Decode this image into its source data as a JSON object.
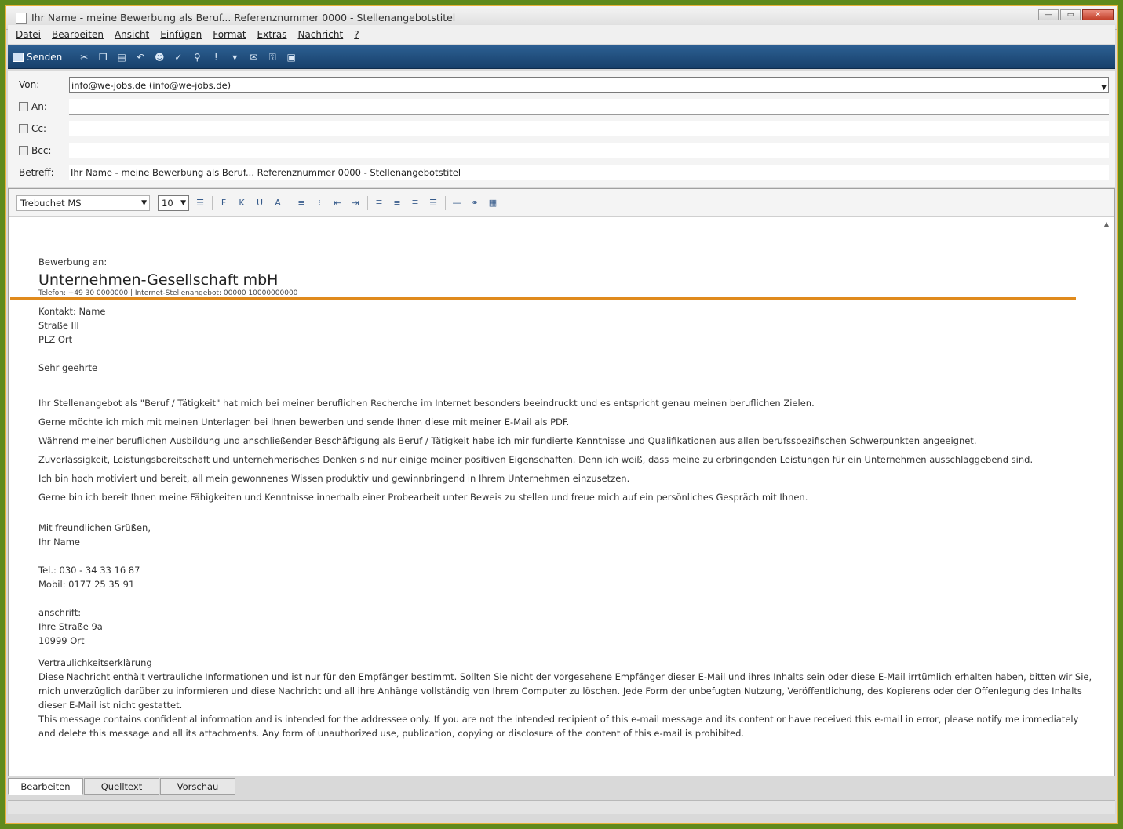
{
  "window": {
    "title": "Ihr Name - meine Bewerbung als Beruf... Referenznummer 0000 - Stellenangebotstitel",
    "controls": [
      "—",
      "▭",
      "✕"
    ]
  },
  "menu": [
    "Datei",
    "Bearbeiten",
    "Ansicht",
    "Einfügen",
    "Format",
    "Extras",
    "Nachricht",
    "?"
  ],
  "toolbar": {
    "send_label": "Senden"
  },
  "header": {
    "from_label": "Von:",
    "from_value": "info@we-jobs.de   (info@we-jobs.de)",
    "to_label": "An:",
    "to_value": "",
    "cc_label": "Cc:",
    "cc_value": "",
    "bcc_label": "Bcc:",
    "bcc_value": "",
    "subject_label": "Betreff:",
    "subject_value": "Ihr Name - meine Bewerbung als Beruf... Referenznummer 0000 - Stellenangebotstitel"
  },
  "format": {
    "font": "Trebuchet MS",
    "size": "10"
  },
  "body": {
    "intro": "Bewerbung an:",
    "company": "Unternehmen-Gesellschaft mbH",
    "company_line": "Telefon: +49 30 0000000 | Internet-Stellenangebot: 00000 10000000000",
    "contact_name": "Kontakt: Name",
    "street": "Straße III",
    "city": "PLZ Ort",
    "salutation": "Sehr geehrte",
    "paragraphs": [
      "Ihr Stellenangebot als \"Beruf / Tätigkeit\" hat mich bei meiner beruflichen Recherche im Internet besonders beeindruckt und es entspricht genau meinen beruflichen Zielen.",
      "Gerne möchte ich mich mit meinen Unterlagen bei Ihnen bewerben und sende Ihnen diese mit meiner E-Mail als PDF.",
      "Während meiner beruflichen Ausbildung und anschließender Beschäftigung als Beruf / Tätigkeit habe ich mir fundierte Kenntnisse und Qualifikationen aus allen berufsspezifischen Schwerpunkten angeeignet.",
      "Zuverlässigkeit, Leistungsbereitschaft und unternehmerisches Denken sind nur einige meiner positiven Eigenschaften. Denn ich weiß, dass meine zu erbringenden Leistungen für ein Unternehmen ausschlaggebend sind.",
      "Ich bin hoch motiviert und bereit, all mein gewonnenes Wissen produktiv und gewinnbringend in Ihrem Unternehmen einzusetzen.",
      "Gerne bin ich bereit Ihnen meine Fähigkeiten und Kenntnisse innerhalb einer Probearbeit unter Beweis zu stellen und freue mich auf ein persönliches Gespräch mit Ihnen."
    ],
    "closing": "Mit freundlichen Grüßen,",
    "signature_name": "Ihr Name",
    "phone": "Tel.: 030 - 34 33 16 87",
    "mobile": "Mobil: 0177 25 35 91",
    "address_label": "anschrift:",
    "address_street": "Ihre Straße 9a",
    "address_city": "10999 Ort",
    "confidential_title": "Vertraulichkeitserklärung",
    "confidential_de": "Diese Nachricht enthält vertrauliche Informationen und ist nur für den Empfänger bestimmt. Sollten Sie nicht der vorgesehene Empfänger dieser E-Mail und ihres Inhalts sein oder diese E-Mail irrtümlich erhalten haben, bitten wir Sie, mich unverzüglich darüber zu informieren und diese Nachricht und all ihre Anhänge vollständig von Ihrem Computer zu löschen. Jede Form der unbefugten Nutzung, Veröffentlichung, des Kopierens oder der Offenlegung des Inhalts dieser E-Mail ist nicht gestattet.",
    "confidential_en": "This message contains confidential information and is intended for the addressee only. If you are not the intended recipient of this e-mail message and its content or have received this e-mail in error, please notify me immediately and delete this message and all its attachments. Any form of unauthorized use, publication, copying or disclosure of the content of this e-mail is prohibited."
  },
  "tabs": [
    "Bearbeiten",
    "Quelltext",
    "Vorschau"
  ]
}
